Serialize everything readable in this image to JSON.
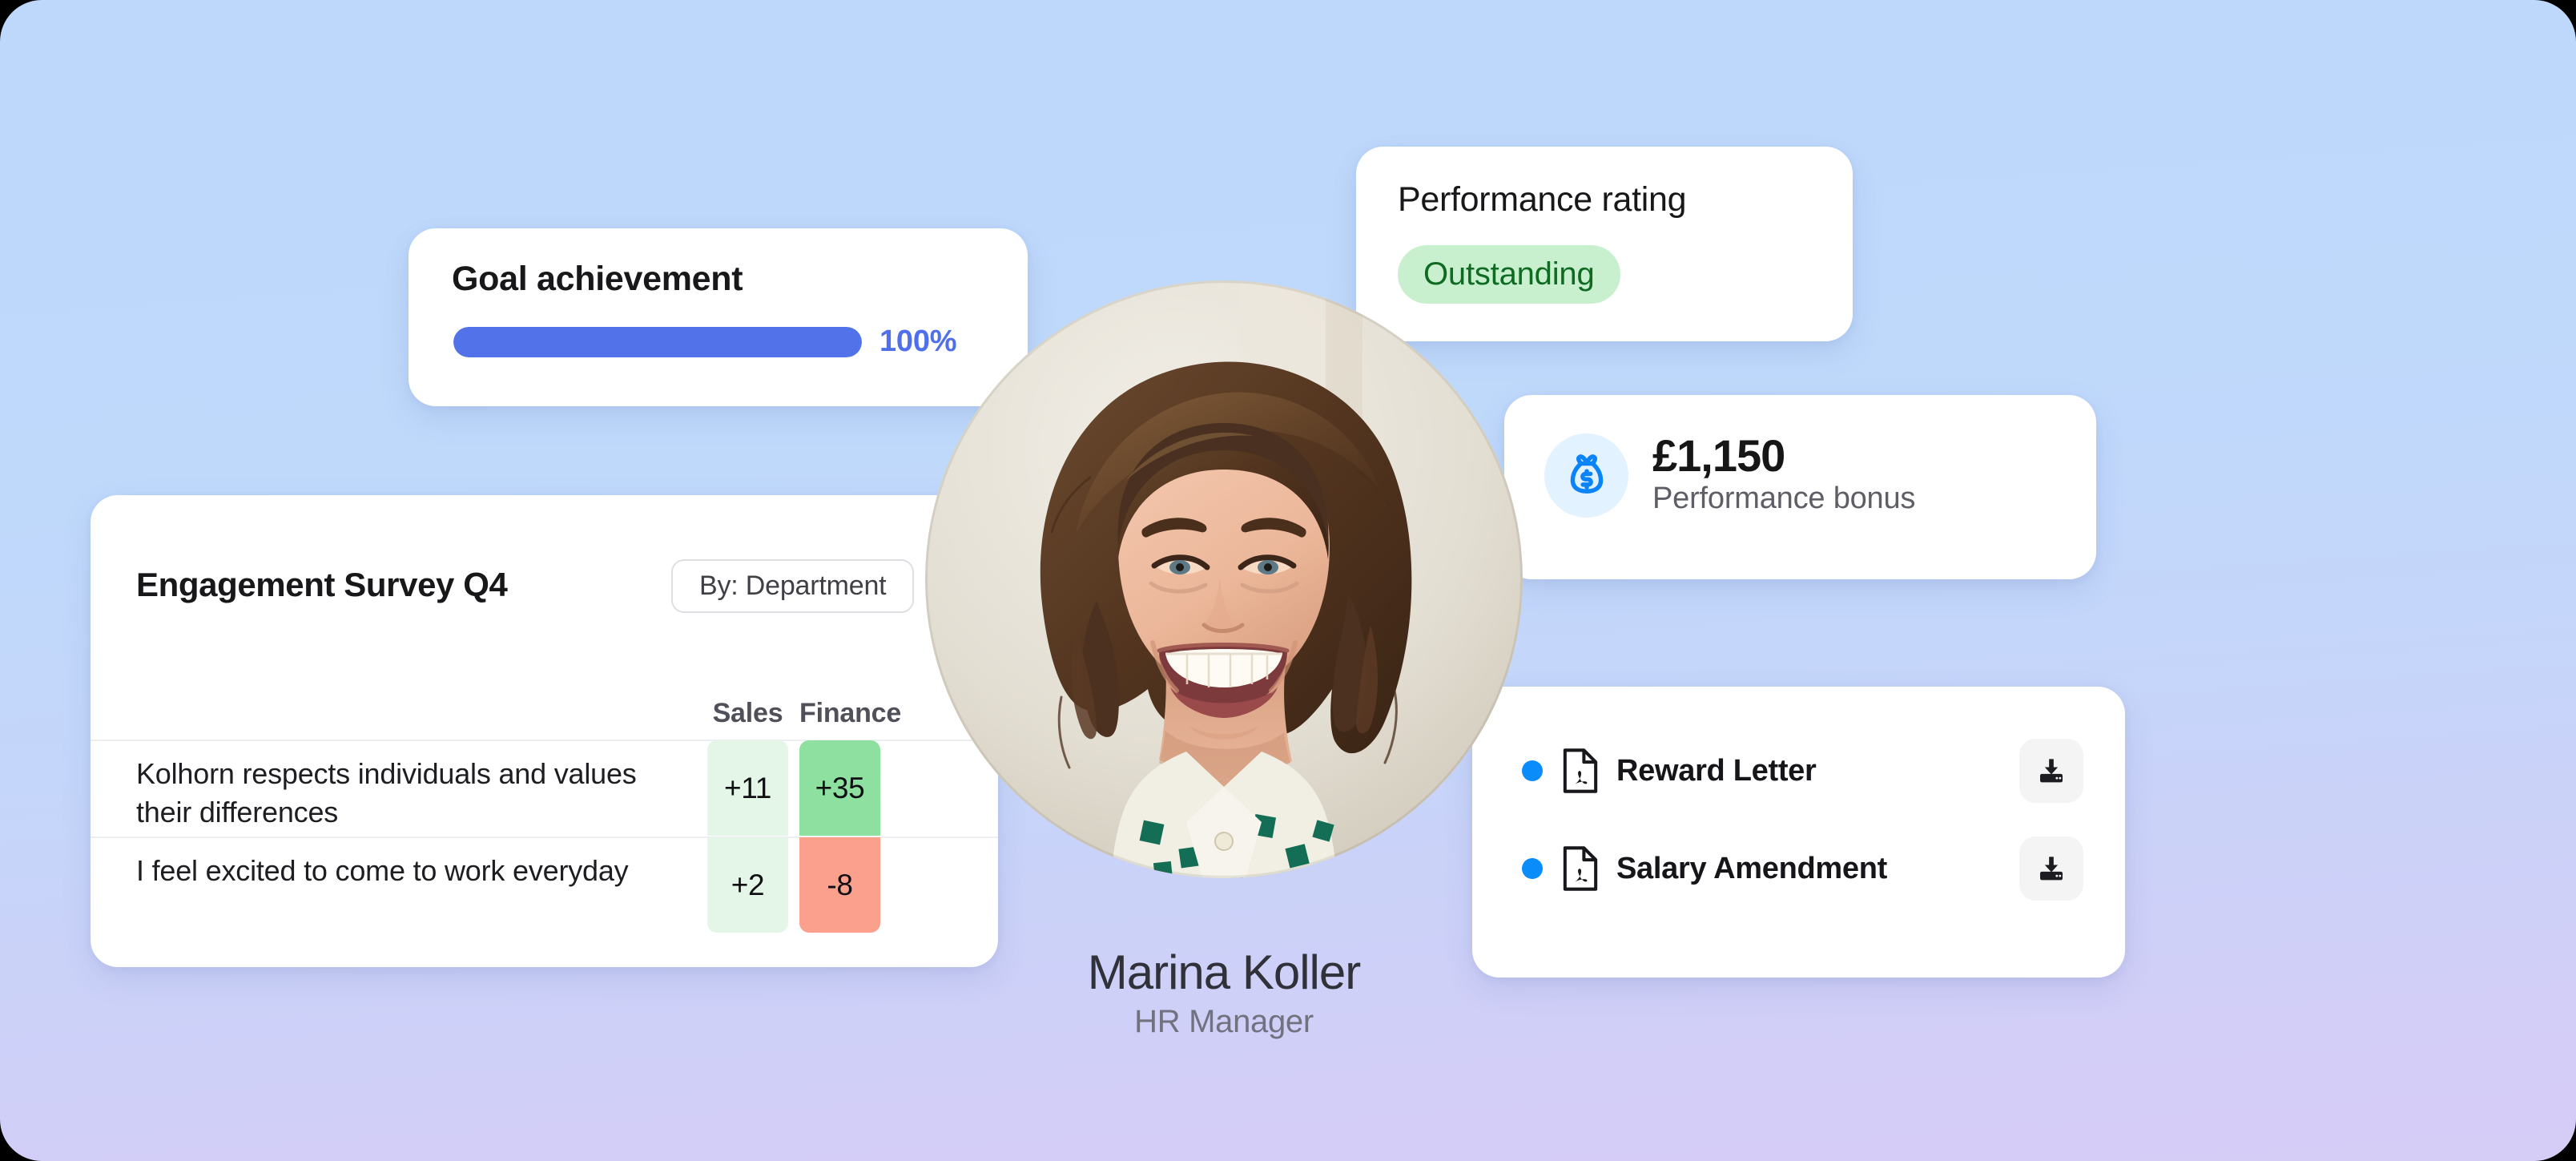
{
  "theme": {
    "bg_top": "#BDD8FB",
    "bg_bottom": "#D6CDF7",
    "accent_blue": "#5272EA",
    "icon_blue": "#0B8CFB",
    "good_green": "#8EE0A1",
    "bad_red": "#FBA08C"
  },
  "goal_card": {
    "title": "Goal achievement",
    "percent_label": "100%",
    "percent_value": 100
  },
  "rating_card": {
    "title": "Performance rating",
    "badge_label": "Outstanding"
  },
  "bonus_card": {
    "icon": "money-bag-icon",
    "amount": "£1,150",
    "label": "Performance bonus"
  },
  "documents_card": {
    "items": [
      {
        "name": "Reward Letter",
        "file_icon": "pdf-file-icon",
        "status_dot": "blue",
        "action": "download-icon"
      },
      {
        "name": "Salary Amendment",
        "file_icon": "pdf-file-icon",
        "status_dot": "blue",
        "action": "download-icon"
      }
    ]
  },
  "survey_card": {
    "title": "Engagement Survey Q4",
    "filter_label": "By: Department",
    "columns": [
      "Sales",
      "Finance"
    ],
    "rows": [
      {
        "question": "Kolhorn respects individuals and values their differences",
        "cells": [
          {
            "value": "+11",
            "color": "#E4F6E8"
          },
          {
            "value": "+35",
            "color": "#8EE0A1"
          }
        ]
      },
      {
        "question": "I feel excited to come to work everyday",
        "cells": [
          {
            "value": "+2",
            "color": "#E4F6E8"
          },
          {
            "value": "-8",
            "color": "#FBA08C"
          }
        ]
      }
    ]
  },
  "profile": {
    "name": "Marina Koller",
    "role": "HR Manager",
    "avatar": "profile-photo"
  },
  "chart_data": {
    "type": "heatmap",
    "title": "Engagement Survey Q4",
    "categories": [
      "Sales",
      "Finance"
    ],
    "rows": [
      "Kolhorn respects individuals and values their differences",
      "I feel excited to come to work everyday"
    ],
    "values": [
      [
        11,
        35
      ],
      [
        2,
        -8
      ]
    ],
    "xlabel": "",
    "ylabel": "",
    "legend": "none",
    "grid": false
  }
}
